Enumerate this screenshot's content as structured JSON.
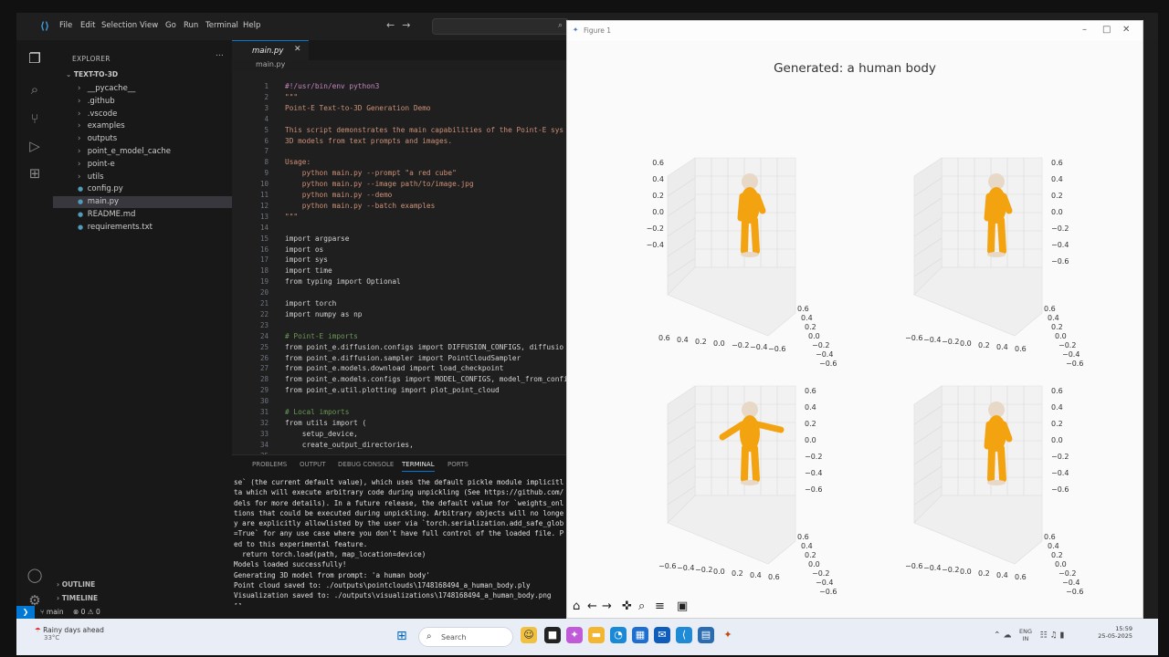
{
  "vscode": {
    "menu": [
      "File",
      "Edit",
      "Selection",
      "View",
      "Go",
      "Run",
      "Terminal",
      "Help"
    ],
    "explorer_title": "EXPLORER",
    "project": "TEXT-TO-3D",
    "tree": [
      {
        "label": "__pycache__",
        "kind": "folder"
      },
      {
        "label": ".github",
        "kind": "folder"
      },
      {
        "label": ".vscode",
        "kind": "folder"
      },
      {
        "label": "examples",
        "kind": "folder"
      },
      {
        "label": "outputs",
        "kind": "folder"
      },
      {
        "label": "point_e_model_cache",
        "kind": "folder"
      },
      {
        "label": "point-e",
        "kind": "folder"
      },
      {
        "label": "utils",
        "kind": "folder"
      },
      {
        "label": "config.py",
        "kind": "file"
      },
      {
        "label": "main.py",
        "kind": "file"
      },
      {
        "label": "README.md",
        "kind": "file"
      },
      {
        "label": "requirements.txt",
        "kind": "file"
      }
    ],
    "outline": "OUTLINE",
    "timeline": "TIMELINE",
    "tab": "main.py",
    "breadcrumb": "main.py",
    "code": [
      "#!/usr/bin/env python3",
      "\"\"\"",
      "Point-E Text-to-3D Generation Demo",
      "",
      "This script demonstrates the main capabilities of the Point-E sys",
      "3D models from text prompts and images.",
      "",
      "Usage:",
      "    python main.py --prompt \"a red cube\"",
      "    python main.py --image path/to/image.jpg",
      "    python main.py --demo",
      "    python main.py --batch examples",
      "\"\"\"",
      "",
      "import argparse",
      "import os",
      "import sys",
      "import time",
      "from typing import Optional",
      "",
      "import torch",
      "import numpy as np",
      "",
      "# Point-E imports",
      "from point_e.diffusion.configs import DIFFUSION_CONFIGS, diffusio",
      "from point_e.diffusion.sampler import PointCloudSampler",
      "from point_e.models.download import load_checkpoint",
      "from point_e.models.configs import MODEL_CONFIGS, model_from_confi",
      "from point_e.util.plotting import plot_point_cloud",
      "",
      "# Local imports",
      "from utils import (",
      "    setup_device,",
      "    create_output_directories,",
      "    ..."
    ],
    "panel_tabs": [
      "PROBLEMS",
      "OUTPUT",
      "DEBUG CONSOLE",
      "TERMINAL",
      "PORTS"
    ],
    "terminal": [
      "se` (the current default value), which uses the default pickle module implicitl",
      "ta which will execute arbitrary code during unpickling (See https://github.com/",
      "dels for more details). In a future release, the default value for `weights_onl",
      "tions that could be executed during unpickling. Arbitrary objects will no longe",
      "y are explicitly allowlisted by the user via `torch.serialization.add_safe_glob",
      "=True` for any use case where you don't have full control of the loaded file. P",
      "ed to this experimental feature.",
      "  return torch.load(path, map_location=device)",
      "Models loaded successfully!",
      "Generating 3D model from prompt: 'a human body'",
      "Point cloud saved to: ./outputs\\pointclouds\\1748168494_a_human_body.ply",
      "Visualization saved to: ./outputs\\visualizations\\1748168494_a_human_body.png",
      "[]"
    ],
    "status": {
      "branch": "main",
      "problems": "0",
      "warnings": "0"
    }
  },
  "figure": {
    "window_title": "Figure 1",
    "suptitle": "Generated: a human body",
    "colors": {
      "body": "#f2a30f",
      "head": "#e8d8c8",
      "grid": "#d9d9d9"
    },
    "subplots": [
      {
        "z_ticks": [
          "0.6",
          "0.4",
          "0.2",
          "0.0",
          "−0.2",
          "−0.4"
        ],
        "x_ticks": [
          "0.6",
          "0.4",
          "0.2",
          "0.0",
          "−0.2",
          "−0.4",
          "−0.6"
        ],
        "y_ticks": [
          "0.6",
          "0.4",
          "0.2",
          "0.0",
          "−0.2",
          "−0.4",
          "−0.6"
        ]
      },
      {
        "z_ticks": [
          "0.6",
          "0.4",
          "0.2",
          "0.0",
          "−0.2",
          "−0.4",
          "−0.6"
        ],
        "x_ticks": [
          "−0.6",
          "−0.4",
          "−0.2",
          "0.0",
          "0.2",
          "0.4",
          "0.6"
        ],
        "y_ticks": [
          "0.6",
          "0.4",
          "0.2",
          "0.0",
          "−0.2",
          "−0.4",
          "−0.6"
        ]
      },
      {
        "z_ticks": [
          "0.6",
          "0.4",
          "0.2",
          "0.0",
          "−0.2",
          "−0.4",
          "−0.6"
        ],
        "x_ticks": [
          "−0.6",
          "−0.4",
          "−0.2",
          "0.0",
          "0.2",
          "0.4",
          "0.6"
        ],
        "y_ticks": [
          "0.6",
          "0.4",
          "0.2",
          "0.0",
          "−0.2",
          "−0.4",
          "−0.6"
        ]
      },
      {
        "z_ticks": [
          "0.6",
          "0.4",
          "0.2",
          "0.0",
          "−0.2",
          "−0.4",
          "−0.6"
        ],
        "x_ticks": [
          "−0.6",
          "−0.4",
          "−0.2",
          "0.0",
          "0.2",
          "0.4",
          "0.6"
        ],
        "y_ticks": [
          "0.6",
          "0.4",
          "0.2",
          "0.0",
          "−0.2",
          "−0.4",
          "−0.6"
        ]
      }
    ],
    "toolbar": [
      "home-icon",
      "back-icon",
      "forward-icon",
      "pan-icon",
      "zoom-icon",
      "configure-icon",
      "save-icon"
    ]
  },
  "taskbar": {
    "weather_title": "Rainy days ahead",
    "weather_temp": "33°C",
    "search": "Search",
    "lang1": "ENG",
    "lang2": "IN",
    "time": "15:59",
    "date": "25-05-2025"
  }
}
